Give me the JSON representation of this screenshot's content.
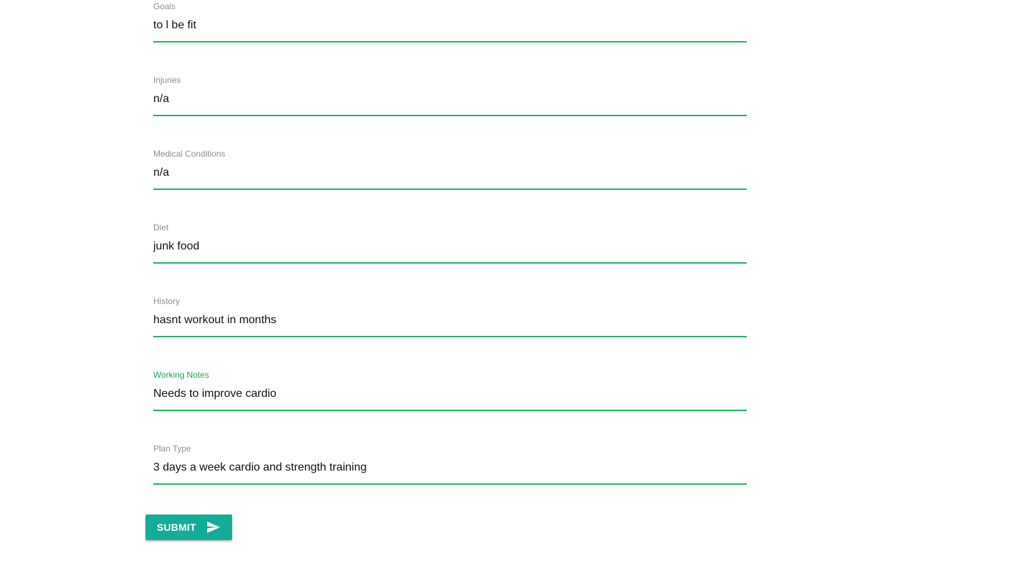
{
  "form": {
    "fields": [
      {
        "label": "Goals",
        "value": "to l be fit"
      },
      {
        "label": "Injuries",
        "value": "n/a"
      },
      {
        "label": "Medical Conditions",
        "value": "n/a"
      },
      {
        "label": "Diet",
        "value": "junk food"
      },
      {
        "label": "History",
        "value": "hasnt workout in months"
      },
      {
        "label": "Working Notes",
        "value": "Needs to improve cardio"
      },
      {
        "label": "Plan Type",
        "value": "3 days a week cardio and strength training"
      }
    ],
    "submit_label": "SUBMIT",
    "submit_icon": "send-icon",
    "accent_color": "#22b45e",
    "focused_label_color": "#1aa659",
    "button_color": "#14ac97"
  }
}
